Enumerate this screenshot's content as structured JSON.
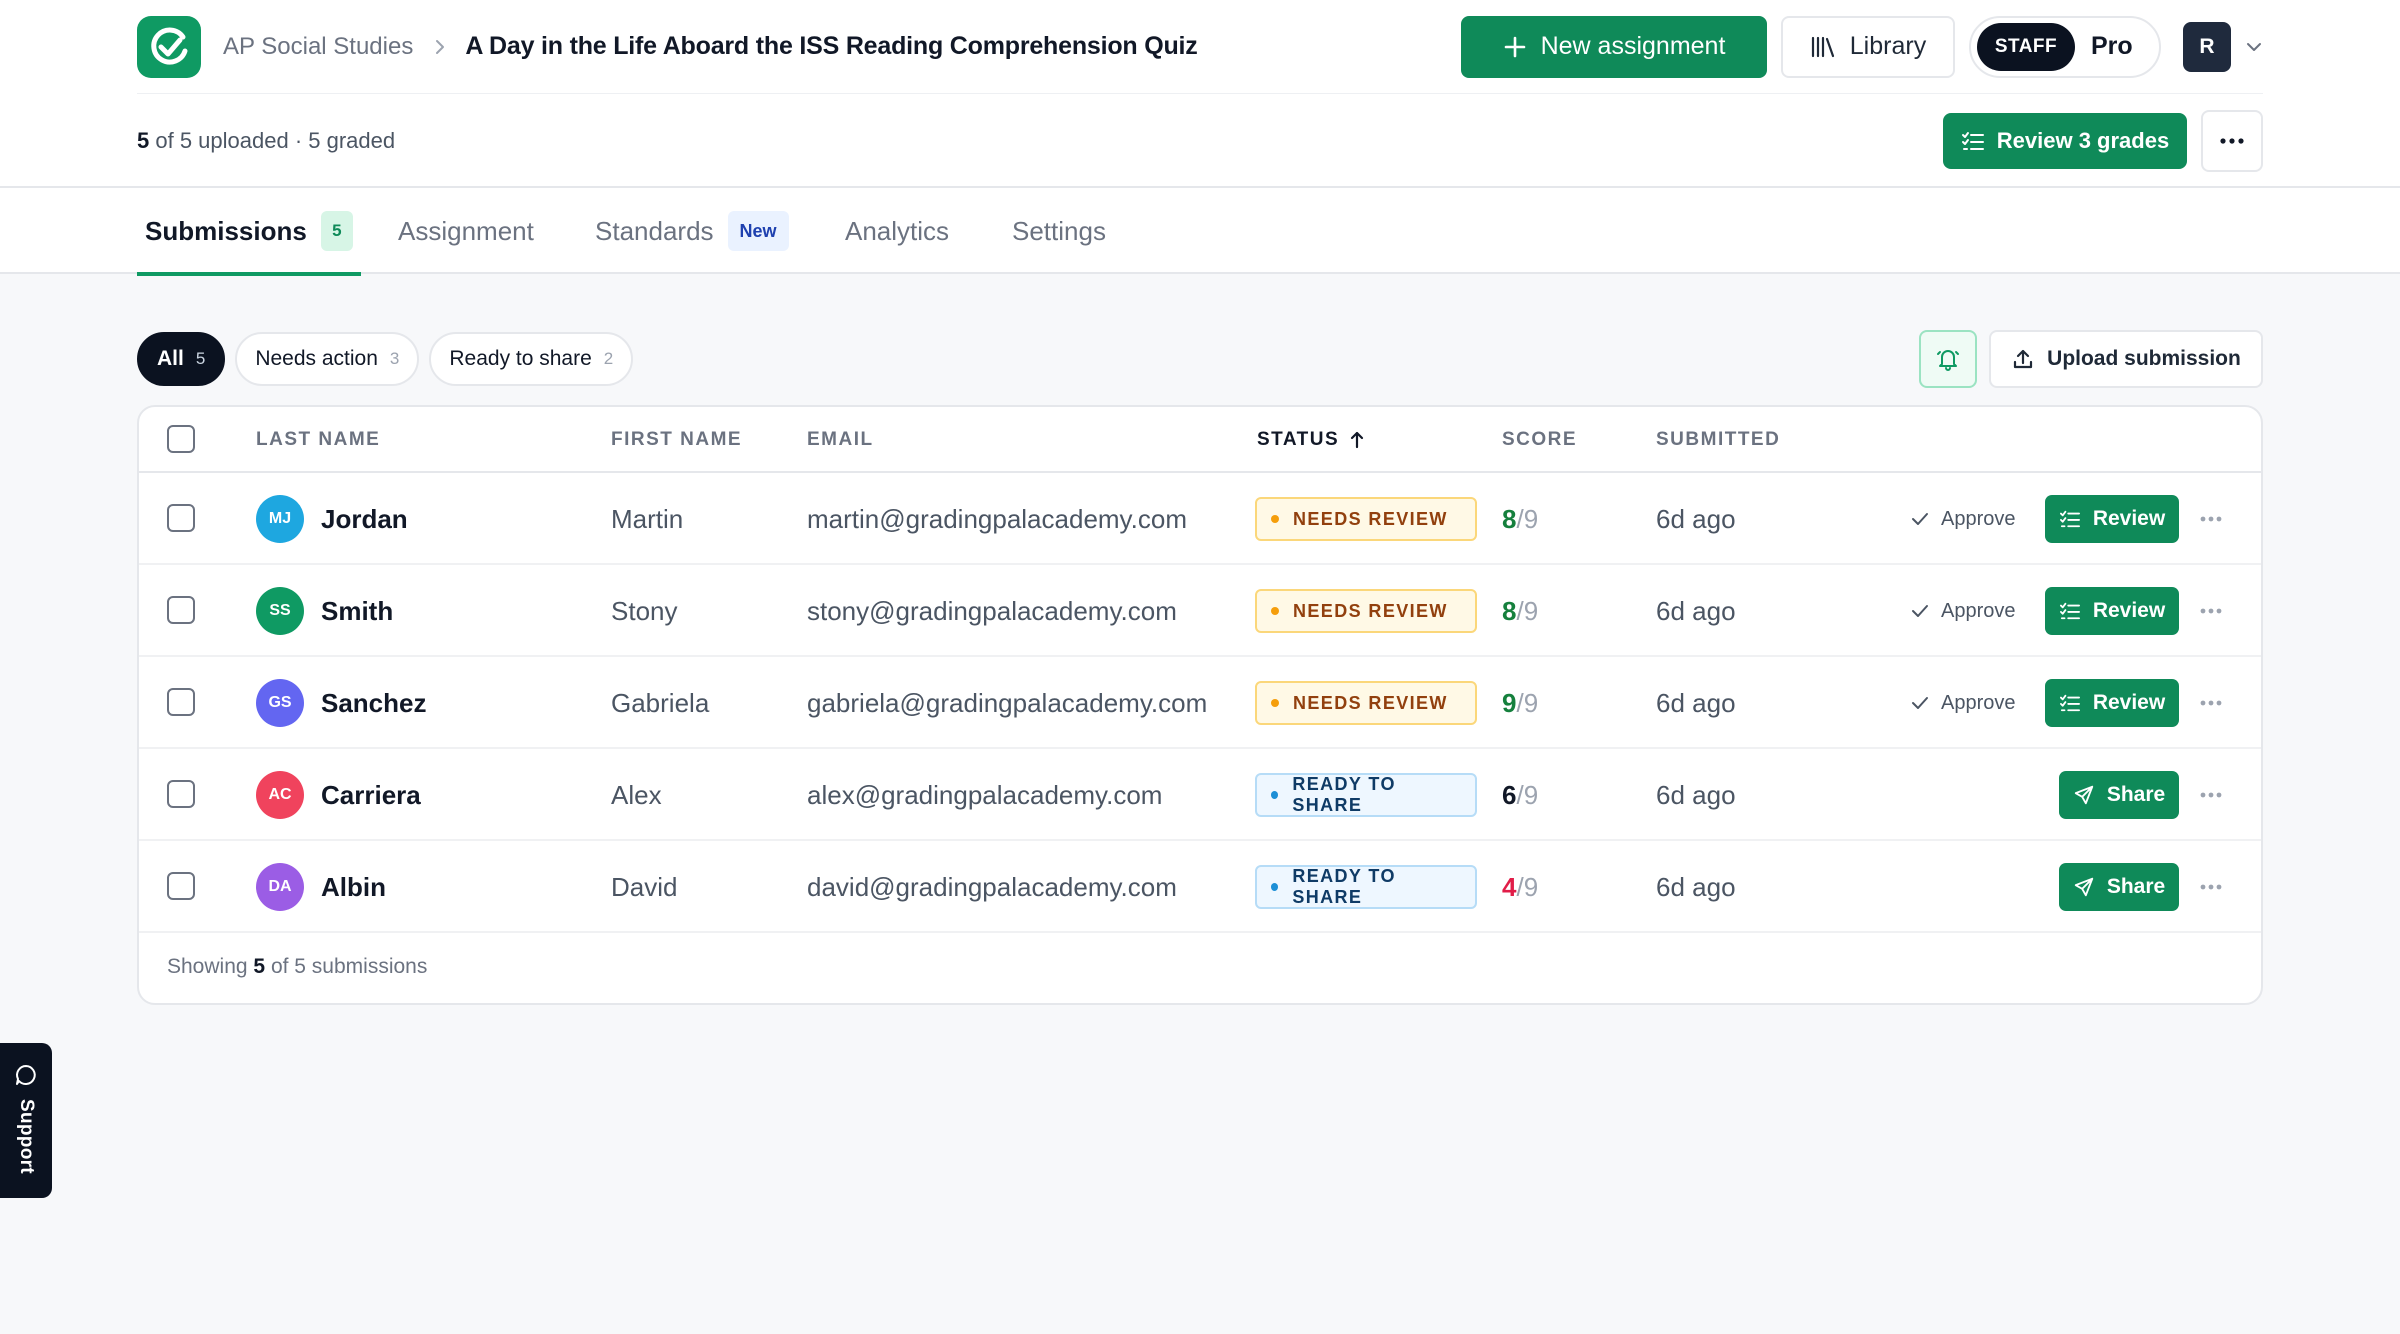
{
  "breadcrumb": {
    "course": "AP Social Studies",
    "title": "A Day in the Life Aboard the ISS Reading Comprehension Quiz"
  },
  "topbar": {
    "new_assignment": "New assignment",
    "library": "Library",
    "staff_badge": "STAFF",
    "plan": "Pro",
    "avatar_initial": "R"
  },
  "subbar": {
    "uploaded_count": "5",
    "uploaded_text": "of 5 uploaded · 5 graded",
    "review_grades": "Review 3 grades"
  },
  "tabs": {
    "submissions": "Submissions",
    "submissions_count": "5",
    "assignment": "Assignment",
    "standards": "Standards",
    "standards_badge": "New",
    "analytics": "Analytics",
    "settings": "Settings"
  },
  "filters": {
    "all": "All",
    "all_count": "5",
    "needs_action": "Needs action",
    "needs_action_count": "3",
    "ready": "Ready to share",
    "ready_count": "2",
    "upload": "Upload submission"
  },
  "table": {
    "columns": {
      "last_name": "LAST NAME",
      "first_name": "FIRST NAME",
      "email": "EMAIL",
      "status": "STATUS",
      "score": "SCORE",
      "submitted": "SUBMITTED"
    },
    "approve_label": "Approve",
    "review_label": "Review",
    "share_label": "Share",
    "rows": [
      {
        "initials": "MJ",
        "avatar_color": "#1ea7e0",
        "last": "Jordan",
        "first": "Martin",
        "email": "martin@gradingpalacademy.com",
        "status": "NEEDS REVIEW",
        "score": "8",
        "total": "/9",
        "score_color": "#15803d",
        "submitted": "6d ago"
      },
      {
        "initials": "SS",
        "avatar_color": "#0f9a63",
        "last": "Smith",
        "first": "Stony",
        "email": "stony@gradingpalacademy.com",
        "status": "NEEDS REVIEW",
        "score": "8",
        "total": "/9",
        "score_color": "#15803d",
        "submitted": "6d ago"
      },
      {
        "initials": "GS",
        "avatar_color": "#6366f1",
        "last": "Sanchez",
        "first": "Gabriela",
        "email": "gabriela@gradingpalacademy.com",
        "status": "NEEDS REVIEW",
        "score": "9",
        "total": "/9",
        "score_color": "#15803d",
        "submitted": "6d ago"
      },
      {
        "initials": "AC",
        "avatar_color": "#f0435d",
        "last": "Carriera",
        "first": "Alex",
        "email": "alex@gradingpalacademy.com",
        "status": "READY TO SHARE",
        "score": "6",
        "total": "/9",
        "score_color": "#111827",
        "submitted": "6d ago"
      },
      {
        "initials": "DA",
        "avatar_color": "#9b5de5",
        "last": "Albin",
        "first": "David",
        "email": "david@gradingpalacademy.com",
        "status": "READY TO SHARE",
        "score": "4",
        "total": "/9",
        "score_color": "#e11d48",
        "submitted": "6d ago"
      }
    ],
    "footer_prefix": "Showing",
    "footer_count": "5",
    "footer_suffix": "of 5 submissions"
  },
  "support": {
    "label": "Support"
  },
  "colors": {
    "brand": "#0f8a59",
    "dark": "#0b1220"
  }
}
